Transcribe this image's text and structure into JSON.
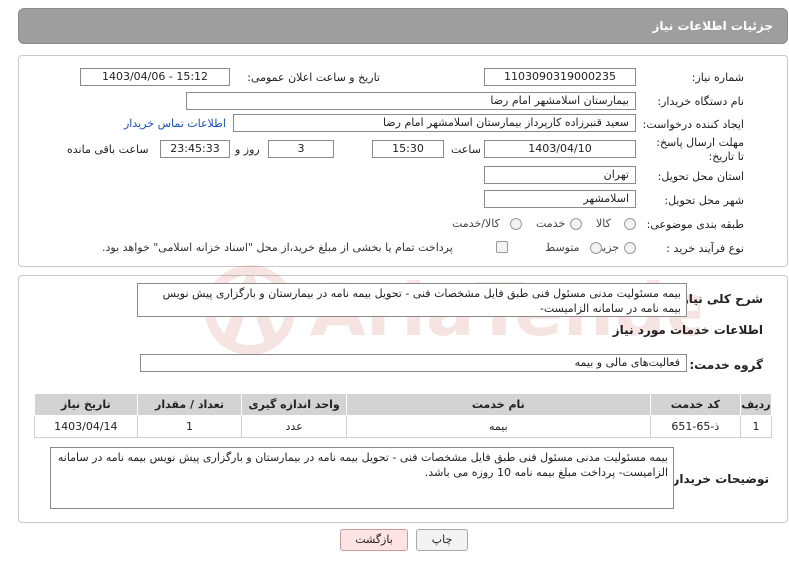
{
  "header": {
    "title": "جزئیات اطلاعات نیاز"
  },
  "form": {
    "need_number": {
      "label": "شماره نیاز:",
      "value": "1103090319000235"
    },
    "announce_datetime": {
      "label": "تاریخ و ساعت اعلان عمومی:",
      "value": "1403/04/06 - 15:12"
    },
    "buyer_org": {
      "label": "نام دستگاه خریدار:",
      "value": "بیمارستان اسلامشهر   امام رضا"
    },
    "requester": {
      "label": "ایجاد کننده درخواست:",
      "value": "سعید قنبرزاده کارپرداز بیمارستان اسلامشهر   امام رضا",
      "contact_link": "اطلاعات تماس خریدار"
    },
    "deadline": {
      "label": "مهلت ارسال پاسخ: تا تاریخ:",
      "date": "1403/04/10",
      "time_label": "ساعت",
      "time": "15:30",
      "days": "3",
      "days_label": "روز و",
      "remaining": "23:45:33",
      "remaining_label": "ساعت باقی مانده"
    },
    "province": {
      "label": "استان محل تحویل:",
      "value": "تهران"
    },
    "city": {
      "label": "شهر محل تحویل:",
      "value": "اسلامشهر"
    },
    "category": {
      "label": "طبقه بندی موضوعی:",
      "options": [
        "کالا",
        "خدمت",
        "کالا/خدمت"
      ]
    },
    "process": {
      "label": "نوع فرآیند خرید :",
      "options": [
        "جزیی",
        "متوسط"
      ],
      "payment_note": "پرداخت تمام یا بخشی از مبلغ خرید،از محل \"اسناد خزانه اسلامی\" خواهد بود."
    }
  },
  "summary": {
    "label": "شرح کلی نیاز:",
    "text": "بیمه مسئولیت مدنی مسئول فنی طبق فایل مشخصات فنی - تحویل بیمه نامه در بیمارستان و بارگزاری پیش نویس بیمه نامه در سامانه الزامیست-"
  },
  "services": {
    "section_title": "اطلاعات خدمات مورد نیاز",
    "group_label": "گروه خدمت:",
    "group_value": "فعالیت‌های مالی و بیمه",
    "columns": [
      "ردیف",
      "کد خدمت",
      "نام خدمت",
      "واحد اندازه گیری",
      "تعداد / مقدار",
      "تاریخ نیاز"
    ],
    "rows": [
      [
        "1",
        "ذ-65-651",
        "بیمه",
        "عدد",
        "1",
        "1403/04/14"
      ]
    ]
  },
  "buyer_notes": {
    "label": "توضیحات خریدار:",
    "text": "بیمه مسئولیت مدنی مسئول فنی طبق فایل مشخصات فنی - تحویل بیمه نامه در بیمارستان و بارگزاری پیش نویس بیمه نامه در سامانه الزامیست- پرداخت مبلغ بیمه نامه 10 روزه می باشد."
  },
  "buttons": {
    "print": "چاپ",
    "back": "بازگشت"
  },
  "watermark": {
    "text": "AriaTender.net"
  },
  "colors": {
    "header_bg": "#9e9e9e",
    "link": "#1a4fbf",
    "watermark": "#c0392b"
  }
}
